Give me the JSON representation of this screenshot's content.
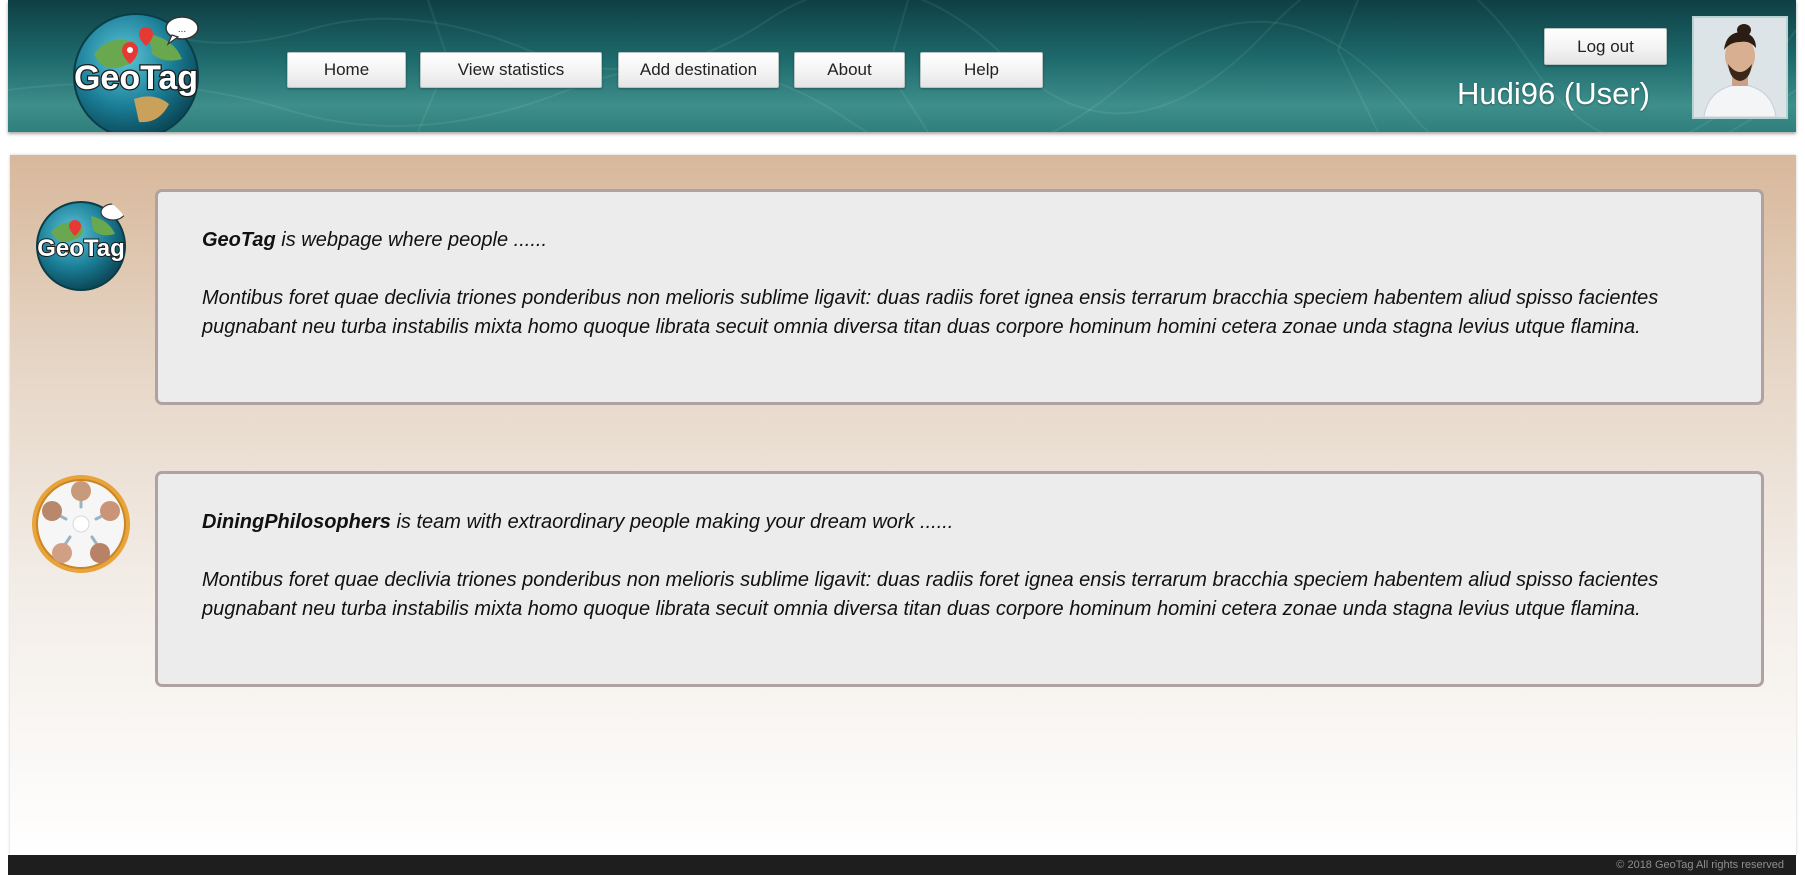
{
  "brand": {
    "logo_text": "GeoTag"
  },
  "nav": {
    "home": "Home",
    "view_statistics": "View statistics",
    "add_destination": "Add destination",
    "about": "About",
    "help": "Help"
  },
  "user": {
    "logout_label": "Log out",
    "display_name": "Hudi96 (User)"
  },
  "cards": [
    {
      "name": "GeoTag",
      "lead_rest": " is webpage where people ......",
      "body": "Montibus foret quae declivia triones ponderibus non melioris sublime ligavit: duas radiis foret ignea ensis terrarum bracchia speciem habentem aliud spisso facientes pugnabant neu turba instabilis mixta homo quoque librata secuit omnia diversa titan duas corpore hominum homini cetera zonae unda stagna levius utque flamina."
    },
    {
      "name": "DiningPhilosophers",
      "lead_rest": " is team with extraordinary people making your dream work ......",
      "body": "Montibus foret quae declivia triones ponderibus non melioris sublime ligavit: duas radiis foret ignea ensis terrarum bracchia speciem habentem aliud spisso facientes pugnabant neu turba instabilis mixta homo quoque librata secuit omnia diversa titan duas corpore hominum homini cetera zonae unda stagna levius utque flamina."
    }
  ],
  "footer": {
    "copyright": "© 2018 GeoTag All rights reserved"
  },
  "colors": {
    "header_teal": "#1e6a6c",
    "main_tan": "#d8b89b",
    "card_border": "#b0a1a2",
    "card_bg": "#ececec",
    "footer_bg": "#1e1e1e"
  },
  "icons": {
    "logo": "globe-map-pin-icon",
    "team": "dining-philosophers-team-icon",
    "avatar": "user-avatar"
  }
}
